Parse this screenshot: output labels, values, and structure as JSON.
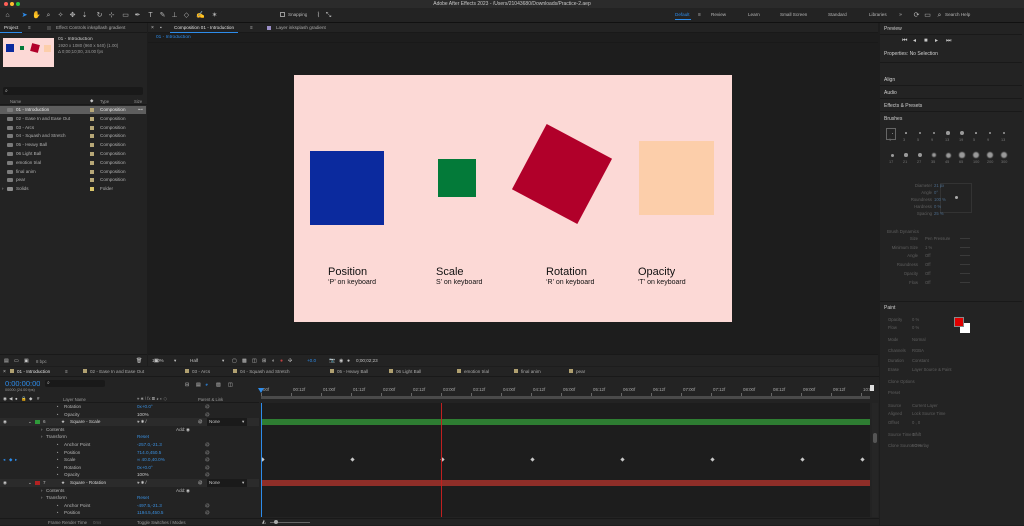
{
  "app": {
    "title": "Adobe After Effects 2023 - /Users/21043680/Downloads/Practice-2.aep"
  },
  "toolbar": {
    "snapping_label": "Snapping",
    "workspaces": [
      "Default",
      "Review",
      "Learn",
      "Small Screen",
      "Standard",
      "Libraries"
    ],
    "active_workspace": "Default",
    "search_placeholder": "Search Help"
  },
  "project_panel": {
    "tabs": [
      "Project",
      "Effect Controls inkspllash gradient"
    ],
    "thumb_name": "01 - Introduction",
    "thumb_info_1": "1920 x 1080 (960 x 540) (1.00)",
    "thumb_info_2": "Δ 0;00;10;00, 24.00 fps",
    "search_placeholder": "",
    "col_name": "Name",
    "col_type": "Type",
    "col_size": "Size",
    "items": [
      {
        "name": "01 - Introduction",
        "type": "Composition",
        "swatch": "#b8a877",
        "selected": true
      },
      {
        "name": "02 - Ease In and Ease Out",
        "type": "Composition",
        "swatch": "#b8a877"
      },
      {
        "name": "03 - Arcs",
        "type": "Composition",
        "swatch": "#b8a877"
      },
      {
        "name": "04 - Squash and Stretch",
        "type": "Composition",
        "swatch": "#b8a877"
      },
      {
        "name": "05 - Heavy Ball",
        "type": "Composition",
        "swatch": "#b8a877"
      },
      {
        "name": "06 Light Ball",
        "type": "Composition",
        "swatch": "#b8a877"
      },
      {
        "name": "emotion trial",
        "type": "Composition",
        "swatch": "#b8a877"
      },
      {
        "name": "final anim",
        "type": "Composition",
        "swatch": "#b8a877"
      },
      {
        "name": "pear",
        "type": "Composition",
        "swatch": "#b8a877"
      },
      {
        "name": "Solids",
        "type": "Folder",
        "swatch": "#d8c46a"
      }
    ],
    "footer_bpc": "8 bpc"
  },
  "composition_panel": {
    "tab_composition": "Composition 01 - Introduction",
    "tab_layer": "Layer inksplash gradient",
    "breadcrumb": "01 - Introduction",
    "canvas_bg": "#fcd9d6",
    "shapes": [
      {
        "label": "Position",
        "hint": "‘P’ on keyboard",
        "color": "#0b2a9e"
      },
      {
        "label": "Scale",
        "hint": "S’ on keyboard",
        "color": "#037a39"
      },
      {
        "label": "Rotation",
        "hint": "‘R’ on keyboard",
        "color": "#b1002a"
      },
      {
        "label": "Opacity",
        "hint": "‘T’ on keyboard",
        "color": "#fcceaa"
      }
    ],
    "footer": {
      "zoom": "100%",
      "resolution": "Half",
      "timecode": "0;00;02;23",
      "exposure": "+0.0"
    }
  },
  "right_panel": {
    "preview": "Preview",
    "properties": "Properties: No Selection",
    "align": "Align",
    "audio": "Audio",
    "effects": "Effects & Presets",
    "brushes": "Brushes",
    "brush_sizes": [
      "1",
      "3",
      "5",
      "9",
      "13",
      "19",
      "5",
      "9",
      "13",
      "17",
      "21",
      "27",
      "35",
      "45",
      "65",
      "100",
      "200",
      "300"
    ],
    "brush_props": [
      {
        "k": "Diameter",
        "v": "21 px"
      },
      {
        "k": "Angle",
        "v": "0°"
      },
      {
        "k": "Roundness",
        "v": "100 %"
      },
      {
        "k": "Hardness",
        "v": "0 %"
      },
      {
        "k": "Spacing",
        "v": "25 %"
      }
    ],
    "brush_dynamics": "Brush Dynamics",
    "dyn_rows": [
      {
        "k": "Size",
        "v": "Pen Pressure"
      },
      {
        "k": "Minimum Size",
        "v": "1 %"
      },
      {
        "k": "Angle",
        "v": "Off"
      },
      {
        "k": "Roundness",
        "v": "Off"
      },
      {
        "k": "Opacity",
        "v": "Off"
      },
      {
        "k": "Flow",
        "v": "Off"
      }
    ],
    "paint": "Paint",
    "paint_rows": [
      {
        "k": "Opacity",
        "v": "0 %"
      },
      {
        "k": "Flow",
        "v": "0 %"
      },
      {
        "k": "Mode",
        "v": "Normal"
      },
      {
        "k": "Channels",
        "v": "RGBA"
      },
      {
        "k": "Duration",
        "v": "Constant"
      },
      {
        "k": "Erase",
        "v": "Layer Source & Paint"
      },
      {
        "k": "Clone Options",
        "v": ""
      },
      {
        "k": "Preset",
        "v": ""
      },
      {
        "k": "Source",
        "v": "Current Layer"
      },
      {
        "k": "Aligned",
        "v": "Lock Source Time"
      },
      {
        "k": "Offset",
        "v": "0 , 0"
      },
      {
        "k": "Source Time Shift",
        "v": "0 f"
      },
      {
        "k": "Clone Source Overlay",
        "v": "50 %"
      }
    ],
    "fg_color": "#e00000",
    "bg_color": "#ffffff"
  },
  "timeline": {
    "tabs": [
      "01 - Introduction",
      "02 - Ease In and Ease Out",
      "03 - Arcs",
      "04 - Squash and Stretch",
      "05 - Heavy Ball",
      "06 Light Ball",
      "emotion trial",
      "final anim",
      "pear"
    ],
    "timecode": "0:00:00:00",
    "timecode_sub": "00000 (24.00 fps)",
    "col_layer_name": "Layer Name",
    "col_parent": "Parent & Link",
    "ruler": [
      "00f",
      "00:12f",
      "01:00f",
      "01:12f",
      "02:00f",
      "02:12f",
      "03:00f",
      "03:12f",
      "04:00f",
      "04:12f",
      "05:00f",
      "05:12f",
      "06:00f",
      "06:12f",
      "07:00f",
      "07:12f",
      "08:00f",
      "08:12f",
      "09:00f",
      "09:12f",
      "10:0"
    ],
    "layers": [
      {
        "kind": "prop",
        "indent": 64,
        "name": "Rotation",
        "value": "0x+0.0°"
      },
      {
        "kind": "prop",
        "indent": 64,
        "name": "Opacity",
        "value": "100%",
        "white": true
      },
      {
        "kind": "layer",
        "num": "6",
        "name": "Square - Scale",
        "color": "#2f9a3a",
        "parent": "None",
        "bar": "#2e7d32"
      },
      {
        "kind": "group",
        "indent": 46,
        "name": "Contents",
        "add": "Add: "
      },
      {
        "kind": "group",
        "indent": 46,
        "name": "Transform",
        "value": "Reset"
      },
      {
        "kind": "prop",
        "indent": 64,
        "name": "Anchor Point",
        "value": "-257.0,-21.3"
      },
      {
        "kind": "prop",
        "indent": 64,
        "name": "Position",
        "value": "714.0,450.5"
      },
      {
        "kind": "prop",
        "indent": 64,
        "name": "Scale",
        "value": "∞ 40.0,40.0%",
        "keyed": true
      },
      {
        "kind": "prop",
        "indent": 64,
        "name": "Rotation",
        "value": "0x+0.0°"
      },
      {
        "kind": "prop",
        "indent": 64,
        "name": "Opacity",
        "value": "100%",
        "white": true
      },
      {
        "kind": "layer",
        "num": "7",
        "name": "Square - Rotation",
        "color": "#b22222",
        "parent": "None",
        "bar": "#8e2e28"
      },
      {
        "kind": "group",
        "indent": 46,
        "name": "Contents",
        "add": "Add: "
      },
      {
        "kind": "group",
        "indent": 46,
        "name": "Transform",
        "value": "Reset"
      },
      {
        "kind": "prop",
        "indent": 64,
        "name": "Anchor Point",
        "value": "-497.5,-21.3"
      },
      {
        "kind": "prop",
        "indent": 64,
        "name": "Position",
        "value": "1194.5,450.5"
      }
    ],
    "scale_keyframes": [
      "00f",
      "01:12f",
      "03:00f",
      "04:12f",
      "06:00f",
      "07:12f",
      "09:00f",
      "10:0"
    ],
    "footer_left": "Frame Render Time",
    "footer_left_val": "0ms",
    "footer_mid": "Toggle Switches / Modes"
  }
}
